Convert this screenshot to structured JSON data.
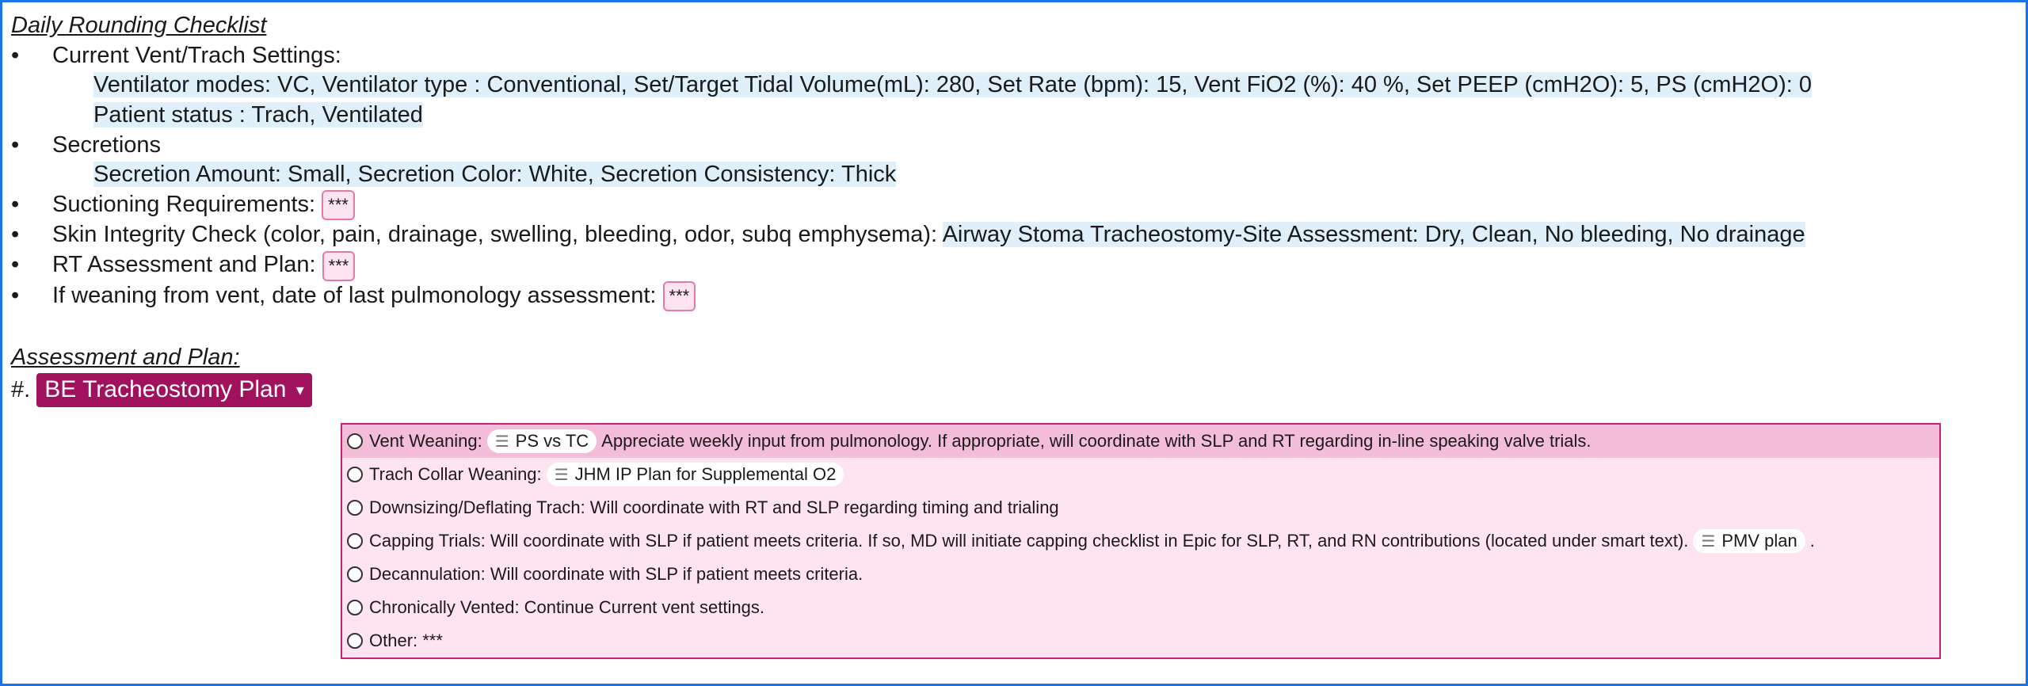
{
  "checklist": {
    "title": "Daily Rounding Checklist",
    "bullet": "•",
    "vent": {
      "label": "Current Vent/Trach Settings:",
      "line1": "Ventilator modes: VC, Ventilator type : Conventional, Set/Target Tidal Volume(mL): 280, Set Rate (bpm): 15, Vent FiO2 (%): 40 %, Set PEEP (cmH2O): 5, PS (cmH2O): 0",
      "line2": "Patient status : Trach, Ventilated"
    },
    "secretions": {
      "label": "Secretions",
      "line1": "Secretion Amount: Small, Secretion Color: White, Secretion Consistency: Thick"
    },
    "suctioning": {
      "label": "Suctioning Requirements:",
      "blank": "***"
    },
    "skin": {
      "label": "Skin Integrity Check (color, pain, drainage, swelling, bleeding, odor, subq emphysema):",
      "value": "Airway Stoma Tracheostomy-Site Assessment: Dry, Clean, No bleeding, No drainage"
    },
    "rt": {
      "label": "RT Assessment and Plan:",
      "blank": "***"
    },
    "weaning": {
      "label": "If weaning from vent, date of last pulmonology assessment:",
      "blank": "***"
    }
  },
  "assessment": {
    "title": "Assessment and Plan:",
    "hash": "#.",
    "dropdown_label": "BE Tracheostomy Plan",
    "dropdown_caret": "▾",
    "options": [
      {
        "prefix": "Vent Weaning:",
        "chip": "PS vs TC",
        "suffix": "Appreciate weekly input from pulmonology. If appropriate, will coordinate with SLP and RT regarding in-line speaking valve trials."
      },
      {
        "prefix": "Trach Collar Weaning:",
        "chip": "JHM IP Plan for Supplemental O2"
      },
      {
        "prefix": "Downsizing/Deflating Trach: Will coordinate with RT and SLP regarding timing and trialing"
      },
      {
        "prefix": "Capping Trials: Will coordinate with SLP if patient meets criteria. If so, MD will initiate capping checklist in Epic for SLP, RT, and RN contributions (located under smart text).",
        "chip": "PMV plan",
        "suffix": "."
      },
      {
        "prefix": "Decannulation: Will coordinate with SLP if patient meets criteria."
      },
      {
        "prefix": "Chronically Vented: Continue Current vent settings."
      },
      {
        "prefix": "Other: ***"
      }
    ]
  },
  "colors": {
    "frame": "#1a73e8",
    "highlight": "#dff0fb",
    "dropdown_bg": "#a0115e",
    "plan_bg": "#fde4f0",
    "plan_border": "#c2247a",
    "active_row": "#f3bcd8"
  },
  "icons": {
    "chip_icon": "list-icon",
    "option_icon": "radio-button-icon"
  }
}
